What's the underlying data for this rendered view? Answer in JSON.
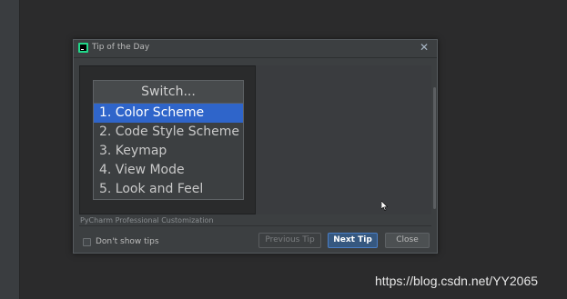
{
  "dialog": {
    "title": "Tip of the Day",
    "close_icon": "close-icon",
    "app_icon": "pycharm-icon"
  },
  "tip": {
    "popup_title": "Switch...",
    "items": [
      {
        "label": "1. Color Scheme",
        "selected": true
      },
      {
        "label": "2. Code Style Scheme",
        "selected": false
      },
      {
        "label": "3. Keymap",
        "selected": false
      },
      {
        "label": "4. View Mode",
        "selected": false
      },
      {
        "label": "5. Look and Feel",
        "selected": false
      }
    ],
    "caption": "PyCharm Professional Customization"
  },
  "footer": {
    "dont_show_label": "Don't show tips",
    "dont_show_checked": false,
    "prev_label": "Previous Tip",
    "next_label": "Next Tip",
    "close_label": "Close"
  },
  "colors": {
    "accent": "#2f65ca",
    "default_button": "#365880",
    "background": "#2b2b2c",
    "dialog": "#3c3f41"
  },
  "watermark": "https://blog.csdn.net/YY2065"
}
